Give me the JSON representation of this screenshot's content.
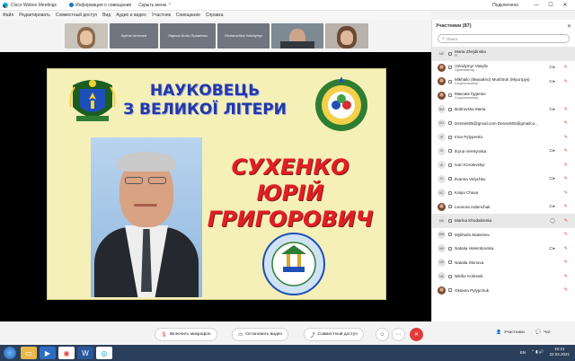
{
  "titlebar": {
    "app_title": "Cisco Webex Meetings",
    "info_label": "Информация о совещании",
    "hide_menu": "Скрыть меню",
    "status": "Подключено",
    "minimize": "—",
    "maximize": "☐",
    "close": "✕"
  },
  "menu": [
    "Файл",
    "Редактировать",
    "Совместный доступ",
    "Вид",
    "Аудио и видео",
    "Участник",
    "Совещание",
    "Справка"
  ],
  "tiles": [
    {
      "name": ""
    },
    {
      "name": "Артем Антонов"
    },
    {
      "name": "Лариса Биль-Праженко"
    },
    {
      "name": "Olcharuchka Volodymyr"
    },
    {
      "name": ""
    },
    {
      "name": ""
    }
  ],
  "slide": {
    "title_line1": "НАУКОВЕЦЬ",
    "title_line2": "З ВЕЛИКОЇ ЛІТЕРИ",
    "name_line1": "СУХЕНКО",
    "name_line2": "ЮРІЙ",
    "name_line3": "ГРИГОРОВИЧ"
  },
  "panel": {
    "title": "Участники (87)",
    "search_placeholder": "Поиск",
    "participants": [
      {
        "initials": "MZ",
        "name": "Maria Zhejdinska",
        "role": "Я",
        "video": "",
        "mic": "",
        "photo": false,
        "selected": true
      },
      {
        "initials": "",
        "name": "Volodymyr Vasyliv",
        "role": "Организатор",
        "video": "⊏▸",
        "mic": "✎",
        "photo": true,
        "selected": false
      },
      {
        "initials": "",
        "name": "Mikhailo (Михайло) Mushtruk (Муштрук)",
        "role": "Соорганизатор",
        "video": "⊏▸",
        "mic": "✎",
        "photo": true,
        "selected": false
      },
      {
        "initials": "",
        "name": "Максим Гуденко",
        "role": "Соорганизатор",
        "video": "",
        "mic": "",
        "photo": true,
        "selected": false
      },
      {
        "initials": "BM",
        "name": "Bobrovska Maria",
        "role": "",
        "video": "⊏▸",
        "mic": "✎",
        "photo": false,
        "selected": false
      },
      {
        "initials": "DG",
        "name": "Dense505@gmail.com Dense505@gmailco...",
        "role": "",
        "video": "",
        "mic": "✎",
        "photo": false,
        "selected": false
      },
      {
        "initials": "IP",
        "name": "Irina Pylypenko",
        "role": "",
        "video": "",
        "mic": "✎",
        "photo": false,
        "selected": false
      },
      {
        "initials": "IV",
        "name": "Ilryna Veretynska",
        "role": "",
        "video": "⊏▸",
        "mic": "✎",
        "photo": false,
        "selected": false
      },
      {
        "initials": "IK",
        "name": "Ivan Korolevskyi",
        "role": "",
        "video": "",
        "mic": "✎",
        "photo": false,
        "selected": false
      },
      {
        "initials": "IV",
        "name": "Ilvanna Velychko",
        "role": "",
        "video": "⊏▸",
        "mic": "✎",
        "photo": false,
        "selected": false
      },
      {
        "initials": "KC",
        "name": "Katya Chava",
        "role": "",
        "video": "",
        "mic": "✎",
        "photo": false,
        "selected": false
      },
      {
        "initials": "",
        "name": "Leonora Adamchuk",
        "role": "",
        "video": "⊏▸",
        "mic": "✎",
        "photo": true,
        "selected": false
      },
      {
        "initials": "MK",
        "name": "Marina Khodakivska",
        "role": "",
        "video": "◯",
        "mic": "✎",
        "photo": false,
        "selected": true
      },
      {
        "initials": "MM",
        "name": "Mykhailo Matvieiev",
        "role": "",
        "video": "",
        "mic": "✎",
        "photo": false,
        "selected": false
      },
      {
        "initials": "NH",
        "name": "Natalia Holembovska",
        "role": "",
        "video": "⊏▸",
        "mic": "✎",
        "photo": false,
        "selected": false
      },
      {
        "initials": "NS",
        "name": "Natalia Slonova",
        "role": "",
        "video": "",
        "mic": "✎",
        "photo": false,
        "selected": false
      },
      {
        "initials": "NK",
        "name": "Nikifor Kolesnik",
        "role": "",
        "video": "",
        "mic": "✎",
        "photo": false,
        "selected": false
      },
      {
        "initials": "",
        "name": "Oksana Pylypchuk",
        "role": "",
        "video": "",
        "mic": "✎",
        "photo": true,
        "selected": false
      }
    ]
  },
  "controls": {
    "mic_label": "Включить микрофон",
    "video_label": "Остановить видео",
    "share_label": "Совместный доступ",
    "participants_tab": "Участники",
    "chat_tab": "Чат"
  },
  "taskbar": {
    "lang": "EN",
    "time": "10:21",
    "date": "22.04.2021"
  },
  "colors": {
    "slide_bg": "#f5f0b8",
    "title_blue": "#2338a6",
    "name_red": "#e01f25",
    "leave_red": "#e23b3b",
    "taskbar": "#2a3f5a"
  }
}
